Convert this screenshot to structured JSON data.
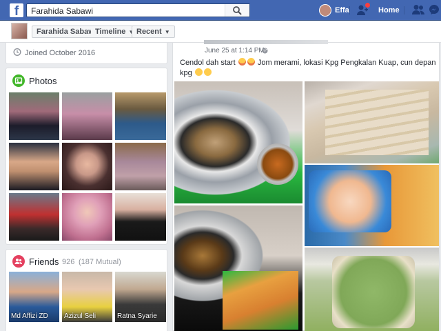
{
  "topbar": {
    "search_value": "Farahida Sabawi",
    "user_name": "Effa",
    "home_label": "Home"
  },
  "profile_nav": {
    "name_button": "Farahida Sabawi",
    "timeline_button": "Timeline",
    "recent_button": "Recent"
  },
  "about": {
    "joined_text": "Joined October 2016"
  },
  "photos": {
    "title": "Photos"
  },
  "friends": {
    "title": "Friends",
    "count": "926",
    "mutual": "(187 Mutual)",
    "items": [
      {
        "name": "Md Affizi ZD"
      },
      {
        "name": "Azizul Seli"
      },
      {
        "name": "Ratna Syarie"
      }
    ]
  },
  "post": {
    "time": "June 25 at 1:14 PM",
    "text_part1": "Cendol dah start",
    "text_part2": "Jom merami, lokasi Kpg Pengkalan Kuap, cun depan kpg"
  },
  "colors": {
    "brand": "#4267b2",
    "photos_icon": "#42b72a",
    "friends_icon": "#e4405f",
    "notification": "#fa3e3e"
  }
}
